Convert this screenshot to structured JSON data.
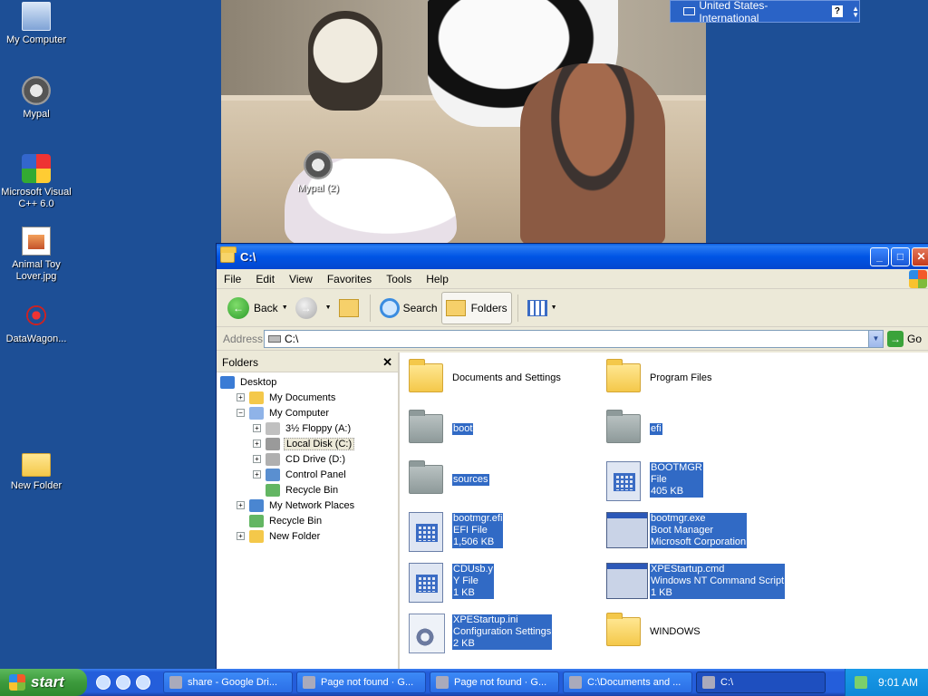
{
  "desktop": {
    "icons": [
      {
        "label": "My Computer",
        "icon": "my-computer-icon"
      },
      {
        "label": "Mypal",
        "icon": "raccoon-icon"
      },
      {
        "label": "Microsoft Visual C++ 6.0",
        "icon": "visual-cpp-icon"
      },
      {
        "label": "Animal Toy Lover.jpg",
        "icon": "image-file-icon"
      },
      {
        "label": "DataWagon...",
        "icon": "datawagon-icon"
      },
      {
        "label": "New Folder",
        "icon": "folder-icon"
      },
      {
        "label": "Mypal (2)",
        "icon": "raccoon-icon"
      }
    ]
  },
  "language_bar": {
    "label": "United States-International",
    "help": "?"
  },
  "window": {
    "title": "C:\\",
    "menu": [
      "File",
      "Edit",
      "View",
      "Favorites",
      "Tools",
      "Help"
    ],
    "toolbar": {
      "back": "Back",
      "search": "Search",
      "folders": "Folders"
    },
    "address": {
      "label": "Address",
      "value": "C:\\",
      "go": "Go"
    },
    "folders_pane": {
      "title": "Folders",
      "tree": [
        {
          "label": "Desktop",
          "expander": "",
          "level": 0
        },
        {
          "label": "My Documents",
          "expander": "+",
          "level": 1
        },
        {
          "label": "My Computer",
          "expander": "−",
          "level": 1
        },
        {
          "label": "3½ Floppy (A:)",
          "expander": "+",
          "level": 2
        },
        {
          "label": "Local Disk (C:)",
          "expander": "+",
          "level": 2,
          "selected": true
        },
        {
          "label": "CD Drive (D:)",
          "expander": "+",
          "level": 2
        },
        {
          "label": "Control Panel",
          "expander": "+",
          "level": 2
        },
        {
          "label": "Recycle Bin",
          "expander": "",
          "level": 2
        },
        {
          "label": "My Network Places",
          "expander": "+",
          "level": 1
        },
        {
          "label": "Recycle Bin",
          "expander": "",
          "level": 1
        },
        {
          "label": "New Folder",
          "expander": "+",
          "level": 1
        }
      ]
    },
    "files": [
      {
        "name": "Documents and Settings",
        "lines": [],
        "kind": "folder",
        "highlight": false
      },
      {
        "name": "Program Files",
        "lines": [],
        "kind": "folder",
        "highlight": false
      },
      {
        "name": "boot",
        "lines": [],
        "kind": "folder-hidden",
        "highlight": true
      },
      {
        "name": "efi",
        "lines": [],
        "kind": "folder-hidden",
        "highlight": true
      },
      {
        "name": "sources",
        "lines": [],
        "kind": "folder-hidden",
        "highlight": true
      },
      {
        "name": "BOOTMGR",
        "lines": [
          "File",
          "405 KB"
        ],
        "kind": "app",
        "highlight": true
      },
      {
        "name": "bootmgr.efi",
        "lines": [
          "EFI File",
          "1,506 KB"
        ],
        "kind": "app",
        "highlight": true
      },
      {
        "name": "bootmgr.exe",
        "lines": [
          "Boot Manager",
          "Microsoft Corporation"
        ],
        "kind": "exe",
        "highlight": true
      },
      {
        "name": "CDUsb.y",
        "lines": [
          "Y File",
          "1 KB"
        ],
        "kind": "app",
        "highlight": true
      },
      {
        "name": "XPEStartup.cmd",
        "lines": [
          "Windows NT Command Script",
          "1 KB"
        ],
        "kind": "exe",
        "highlight": true
      },
      {
        "name": "XPEStartup.ini",
        "lines": [
          "Configuration Settings",
          "2 KB"
        ],
        "kind": "gear",
        "highlight": true
      },
      {
        "name": "WINDOWS",
        "lines": [],
        "kind": "folder",
        "highlight": false
      }
    ]
  },
  "taskbar": {
    "start": "start",
    "tasks": [
      "share - Google Dri...",
      "Page not found · G...",
      "Page not found · G...",
      "C:\\Documents and ...",
      "C:\\"
    ],
    "clock": "9:01 AM"
  }
}
